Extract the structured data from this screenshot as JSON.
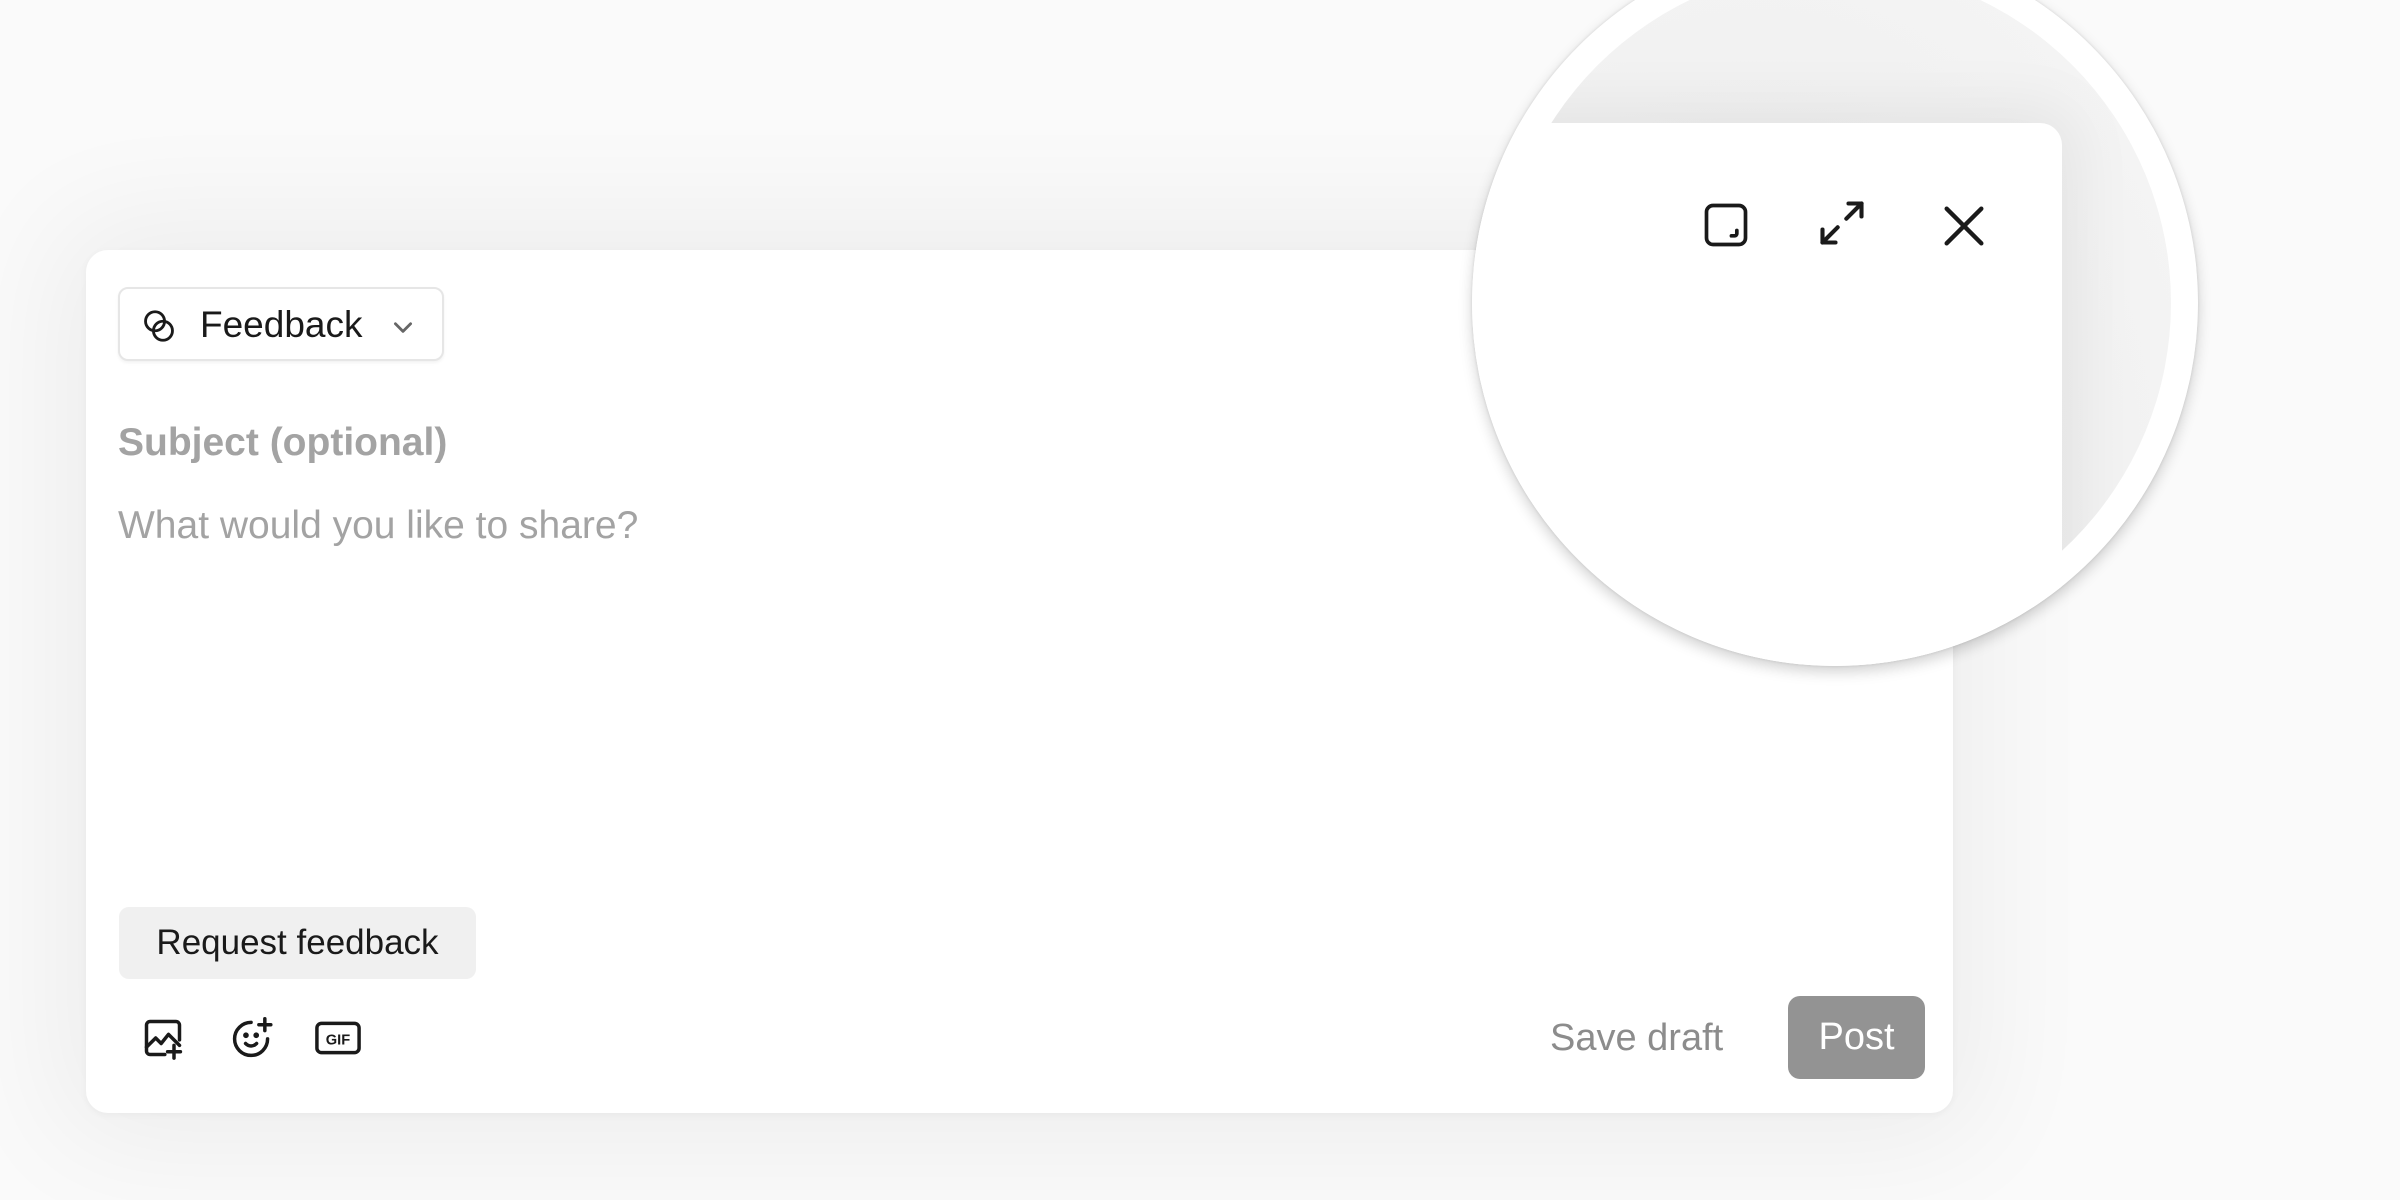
{
  "composer": {
    "post_type": {
      "label": "Feedback",
      "icon": "overlapping-circles-icon"
    },
    "subject": {
      "value": "",
      "placeholder": "Subject (optional)"
    },
    "body": {
      "value": "",
      "placeholder": "What would you like to share?"
    },
    "request_feedback_label": "Request feedback",
    "toolbar": {
      "icons": [
        "image-add-icon",
        "emoji-add-icon",
        "gif-icon"
      ],
      "gif_text": "GIF"
    },
    "save_draft_label": "Save draft",
    "post_label": "Post",
    "post_enabled": false
  },
  "window_controls": {
    "icons": [
      "minimize-to-corner-icon",
      "expand-icon",
      "close-icon"
    ]
  },
  "colors": {
    "background": "#fafafa",
    "card": "#ffffff",
    "text_primary": "#1a1a1a",
    "placeholder": "#a3a3a3",
    "chip_bg": "#f0f0f0",
    "secondary_text": "#8c8c8c",
    "post_disabled_bg": "#939393"
  }
}
